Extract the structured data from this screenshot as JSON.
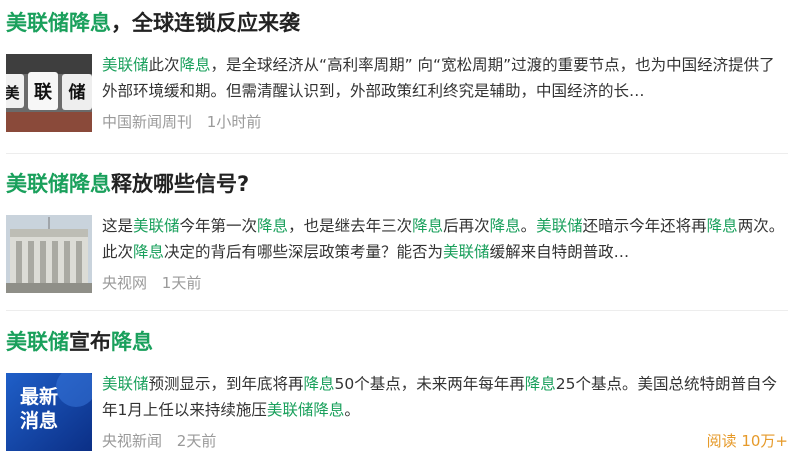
{
  "news": [
    {
      "title": [
        {
          "t": "美联储降息",
          "hl": true
        },
        {
          "t": "，全球连锁反应来袭",
          "hl": false
        }
      ],
      "summary": [
        {
          "t": "美联储",
          "hl": true
        },
        {
          "t": "此次",
          "hl": false
        },
        {
          "t": "降息",
          "hl": true
        },
        {
          "t": "，是全球经济从“高利率周期” 向“宽松周期”过渡的重要节点，也为中国经济提供了外部环境缓和期。但需清醒认识到，外部政策红利终究是辅助，中国经济的长…",
          "hl": false
        }
      ],
      "source": "中国新闻周刊",
      "time": "1小时前",
      "thumb_icon": "dice-letters-image"
    },
    {
      "title": [
        {
          "t": "美联储降息",
          "hl": true
        },
        {
          "t": "释放哪些信号?",
          "hl": false
        }
      ],
      "summary": [
        {
          "t": "这是",
          "hl": false
        },
        {
          "t": "美联储",
          "hl": true
        },
        {
          "t": "今年第一次",
          "hl": false
        },
        {
          "t": "降息",
          "hl": true
        },
        {
          "t": "，也是继去年三次",
          "hl": false
        },
        {
          "t": "降息",
          "hl": true
        },
        {
          "t": "后再次",
          "hl": false
        },
        {
          "t": "降息",
          "hl": true
        },
        {
          "t": "。",
          "hl": false
        },
        {
          "t": "美联储",
          "hl": true
        },
        {
          "t": "还暗示今年还将再",
          "hl": false
        },
        {
          "t": "降息",
          "hl": true
        },
        {
          "t": "两次。此次",
          "hl": false
        },
        {
          "t": "降息",
          "hl": true
        },
        {
          "t": "决定的背后有哪些深层政策考量？能否为",
          "hl": false
        },
        {
          "t": "美联储",
          "hl": true
        },
        {
          "t": "缓解来自特朗普政…",
          "hl": false
        }
      ],
      "source": "央视网",
      "time": "1天前",
      "thumb_icon": "federal-reserve-building-image"
    },
    {
      "title": [
        {
          "t": "美联储",
          "hl": true
        },
        {
          "t": "宣布",
          "hl": false
        },
        {
          "t": "降息",
          "hl": true
        }
      ],
      "summary": [
        {
          "t": "美联储",
          "hl": true
        },
        {
          "t": "预测显示，到年底将再",
          "hl": false
        },
        {
          "t": "降息",
          "hl": true
        },
        {
          "t": "50个基点，未来两年每年再",
          "hl": false
        },
        {
          "t": "降息",
          "hl": true
        },
        {
          "t": "25个基点。美国总统特朗普自今年1月上任以来持续施压",
          "hl": false
        },
        {
          "t": "美联储降息",
          "hl": true
        },
        {
          "t": "。",
          "hl": false
        }
      ],
      "source": "央视新闻",
      "time": "2天前",
      "reads": "阅读 10万+",
      "thumb_text": [
        "最新",
        "消息"
      ],
      "thumb_icon": "breaking-news-image"
    }
  ],
  "colors": {
    "highlight": "#1aa05c",
    "meta": "#9a9a9a",
    "reads": "#e69a2a"
  }
}
